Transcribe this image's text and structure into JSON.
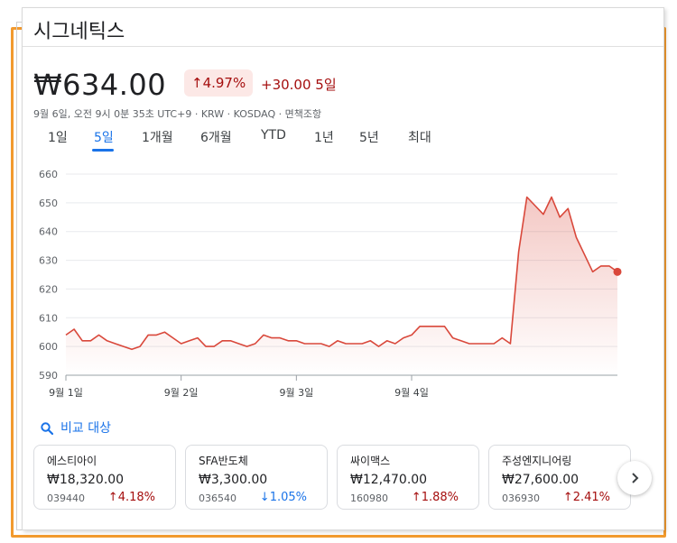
{
  "title": "시그네틱스",
  "price": "₩634.00",
  "pct_change": "4.97%",
  "abs_change": "+30.00",
  "period_label": "5일",
  "meta": "9월 6일, 오전 9시 0분 35초 UTC+9 · KRW · KOSDAQ · 면책조항",
  "tabs": [
    "1일",
    "5일",
    "1개월",
    "6개월",
    "YTD",
    "1년",
    "5년",
    "최대"
  ],
  "active_tab": "5일",
  "compare_label": "비교 대상",
  "colors": {
    "line": "#d9483b",
    "up": "#a50e0e",
    "down": "#1a73e8",
    "accent": "#1a73e8"
  },
  "chart_data": {
    "type": "area",
    "title": "",
    "xlabel": "",
    "ylabel": "",
    "ylim": [
      590,
      660
    ],
    "yticks": [
      590,
      600,
      610,
      620,
      630,
      640,
      650,
      660
    ],
    "xticks": [
      "9월 1일",
      "9월 2일",
      "9월 3일",
      "9월 4일"
    ],
    "grid": true,
    "series": [
      {
        "values": [
          604,
          606,
          602,
          602,
          604,
          602,
          601,
          600,
          599,
          600,
          604,
          604,
          605,
          603,
          601,
          602,
          603,
          600,
          600,
          602,
          602,
          601,
          600,
          601,
          604,
          603,
          603,
          602,
          602,
          601,
          601,
          601,
          600,
          602,
          601,
          601,
          601,
          602,
          600,
          602,
          601,
          603,
          604,
          607,
          607,
          607,
          607,
          603,
          602,
          601,
          601,
          601,
          601,
          603,
          601,
          633,
          652,
          649,
          646,
          652,
          645,
          648,
          638,
          632,
          626,
          628,
          628,
          626
        ]
      }
    ]
  },
  "comparisons": [
    {
      "name": "에스티아이",
      "price": "₩18,320.00",
      "code": "039440",
      "change": "4.18%",
      "dir": "up"
    },
    {
      "name": "SFA반도체",
      "price": "₩3,300.00",
      "code": "036540",
      "change": "1.05%",
      "dir": "down"
    },
    {
      "name": "싸이맥스",
      "price": "₩12,470.00",
      "code": "160980",
      "change": "1.88%",
      "dir": "up"
    },
    {
      "name": "주성엔지니어링",
      "price": "₩27,600.00",
      "code": "036930",
      "change": "2.41%",
      "dir": "up"
    }
  ]
}
